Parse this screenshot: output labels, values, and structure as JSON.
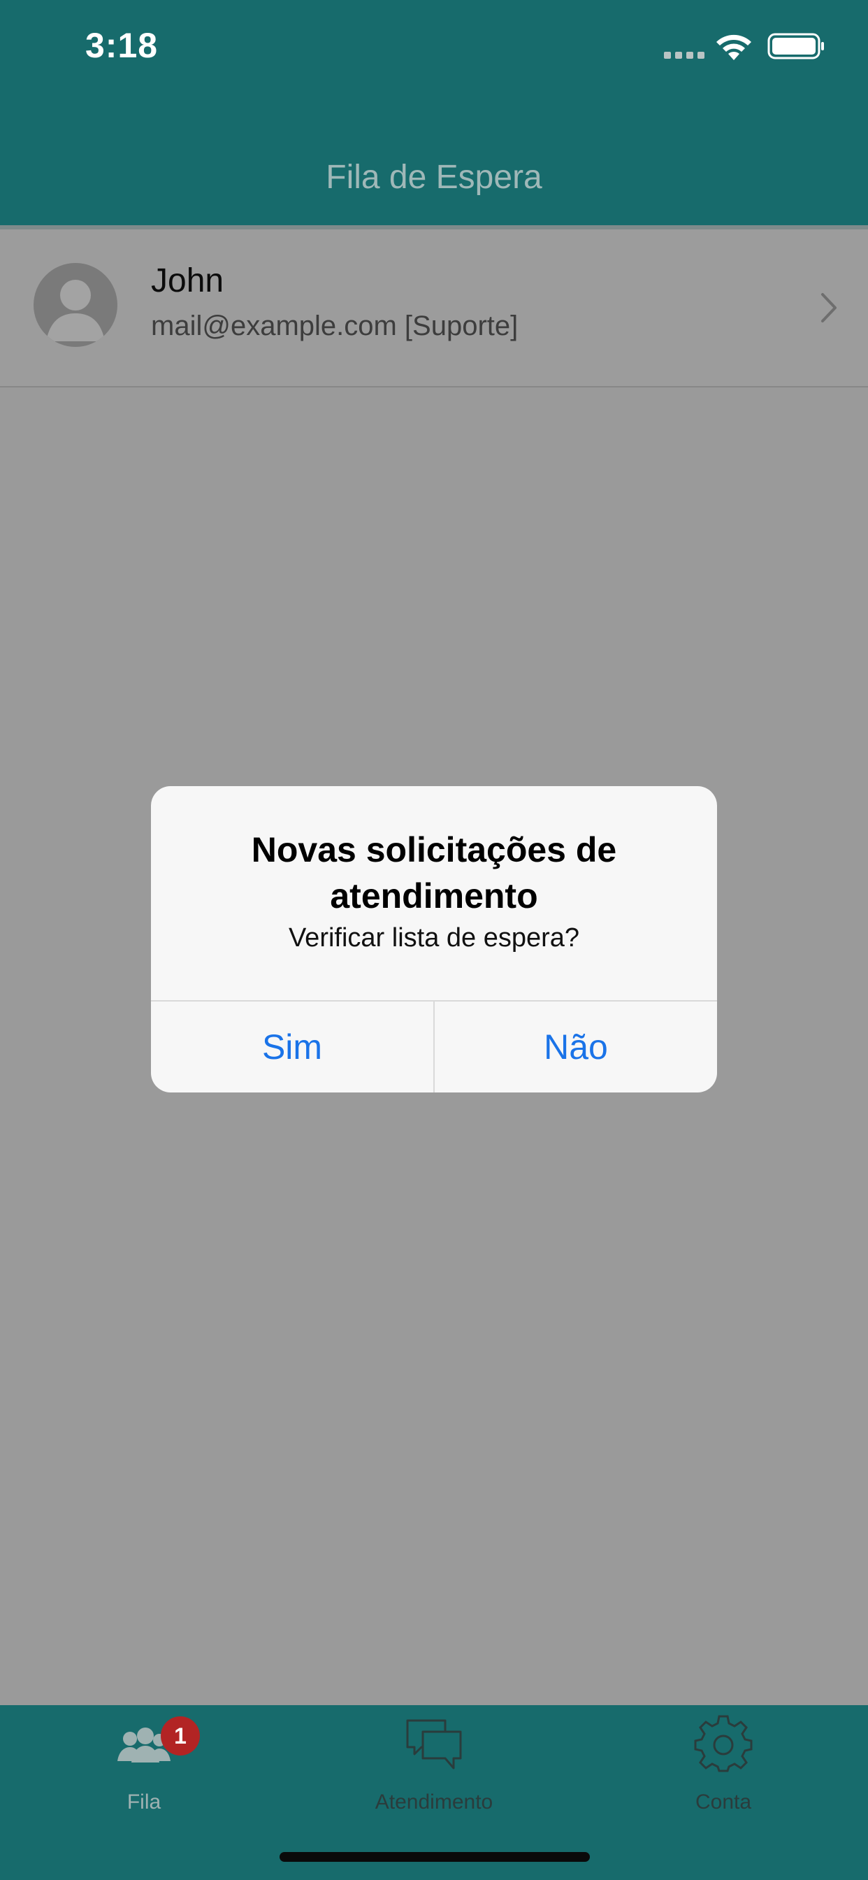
{
  "status_bar": {
    "time": "3:18"
  },
  "nav": {
    "title": "Fila de Espera"
  },
  "queue": {
    "items": [
      {
        "name": "John",
        "subtitle": "mail@example.com [Suporte]"
      }
    ]
  },
  "alert": {
    "title": "Novas solicitações de atendimento",
    "message": "Verificar lista de espera?",
    "buttons": {
      "yes": "Sim",
      "no": "Não"
    }
  },
  "tabbar": {
    "tabs": [
      {
        "label": "Fila",
        "icon": "people-icon",
        "badge": "1",
        "selected": true
      },
      {
        "label": "Atendimento",
        "icon": "chat-bubbles-icon"
      },
      {
        "label": "Conta",
        "icon": "gear-icon"
      }
    ]
  },
  "colors": {
    "primary": "#176b6c",
    "dim_overlay": "#9a9a9a",
    "alert_button": "#1a73e8",
    "badge": "#b22424"
  }
}
